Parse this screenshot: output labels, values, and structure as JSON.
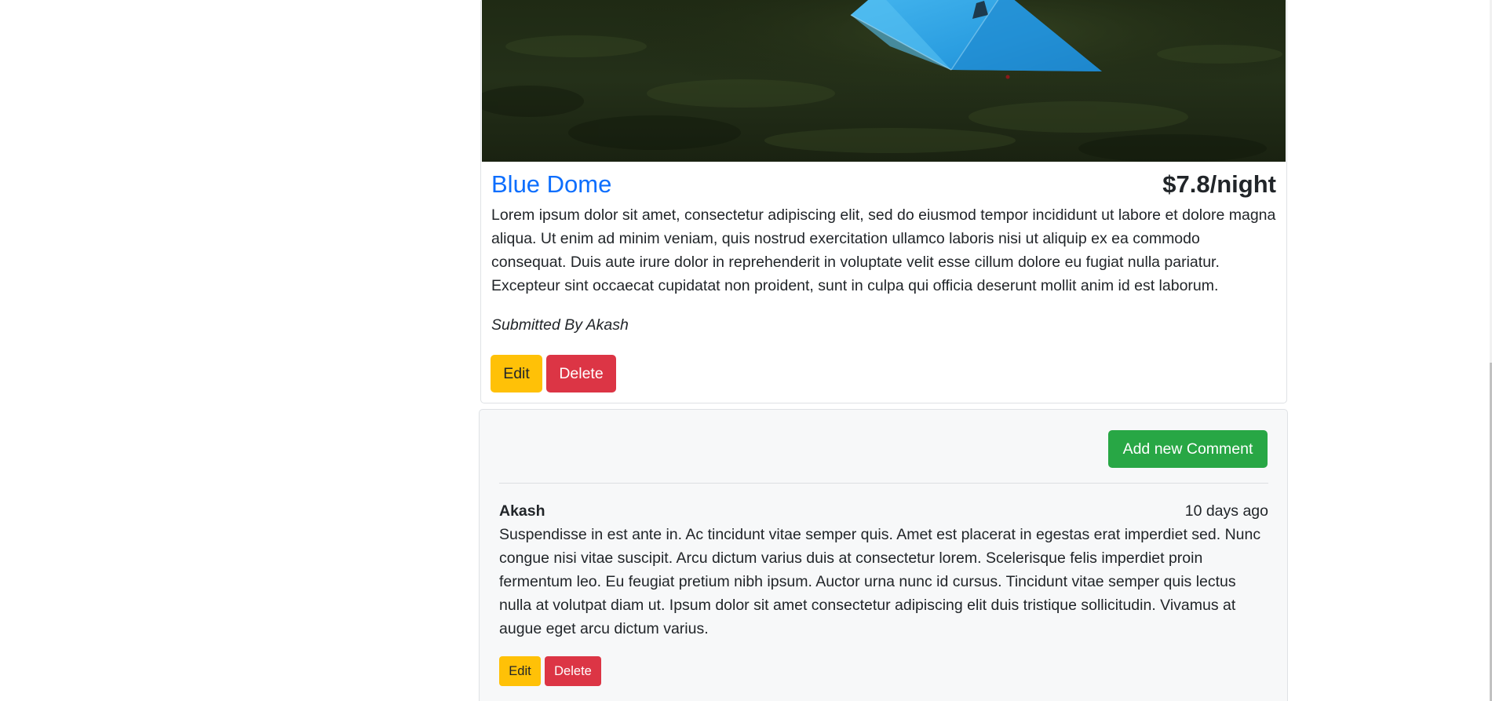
{
  "campground": {
    "title": "Blue Dome",
    "price": "$7.8/night",
    "description": "Lorem ipsum dolor sit amet, consectetur adipiscing elit, sed do eiusmod tempor incididunt ut labore et dolore magna aliqua. Ut enim ad minim veniam, quis nostrud exercitation ullamco laboris nisi ut aliquip ex ea commodo consequat. Duis aute irure dolor in reprehenderit in voluptate velit esse cillum dolore eu fugiat nulla pariatur. Excepteur sint occaecat cupidatat non proident, sunt in culpa qui officia deserunt mollit anim id est laborum.",
    "submitted_by": "Submitted By Akash",
    "edit_label": "Edit",
    "delete_label": "Delete"
  },
  "comments": {
    "add_label": "Add new Comment",
    "items": [
      {
        "author": "Akash",
        "time": "10 days ago",
        "text": "Suspendisse in est ante in. Ac tincidunt vitae semper quis. Amet est placerat in egestas erat imperdiet sed. Nunc congue nisi vitae suscipit. Arcu dictum varius duis at consectetur lorem. Scelerisque felis imperdiet proin fermentum leo. Eu feugiat pretium nibh ipsum. Auctor urna nunc id cursus. Tincidunt vitae semper quis lectus nulla at volutpat diam ut. Ipsum dolor sit amet consectetur adipiscing elit duis tristique sollicitudin. Vivamus at augue eget arcu dictum varius.",
        "edit_label": "Edit",
        "delete_label": "Delete"
      }
    ]
  },
  "colors": {
    "link": "#0d6efd",
    "warning": "#ffc107",
    "danger": "#dc3545",
    "success": "#28a745"
  }
}
